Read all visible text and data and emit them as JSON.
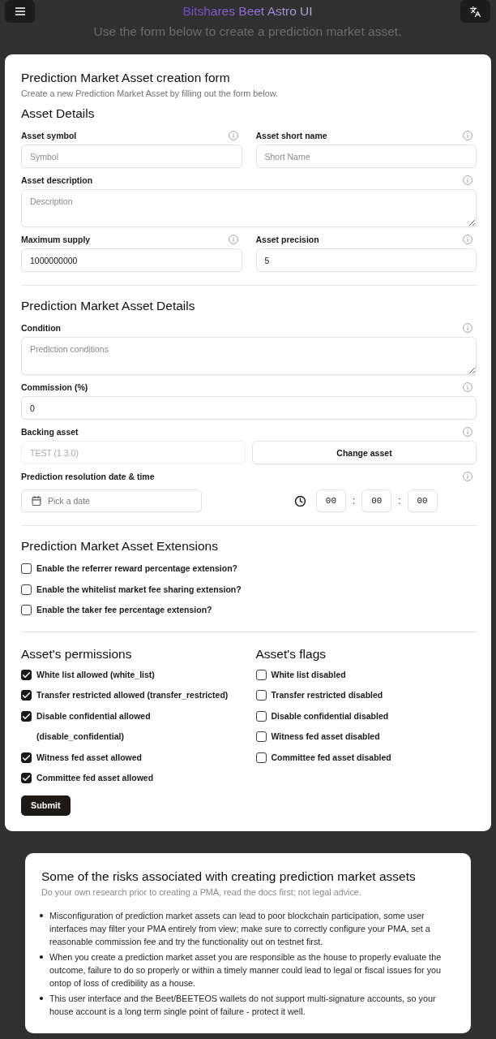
{
  "header": {
    "title": "Bitshares Beet Astro UI",
    "subtitle": "Use the form below to create a prediction market asset."
  },
  "form": {
    "title": "Prediction Market Asset creation form",
    "description": "Create a new Prediction Market Asset by filling out the form below.",
    "sections": [
      {
        "title": "Asset Details",
        "rows": [
          [
            {
              "kind": "text",
              "label": "Asset symbol",
              "placeholder": "Symbol"
            },
            {
              "kind": "text",
              "label": "Asset short name",
              "placeholder": "Short Name"
            }
          ],
          [
            {
              "kind": "textarea",
              "label": "Asset description",
              "placeholder": "Description"
            }
          ],
          [
            {
              "kind": "text",
              "label": "Maximum supply",
              "value": "1000000000"
            },
            {
              "kind": "text",
              "label": "Asset precision",
              "value": "5"
            }
          ]
        ]
      },
      {
        "title": "Prediction Market Asset Details",
        "rows": [
          [
            {
              "kind": "textarea",
              "label": "Condition",
              "placeholder": "Prediction conditions"
            }
          ],
          [
            {
              "kind": "text",
              "label": "Commission (%)",
              "value": "0"
            }
          ],
          [
            {
              "kind": "asset",
              "label": "Backing asset",
              "value": "TEST (1.3.0)",
              "disabled": true,
              "button": "Change asset"
            }
          ],
          [
            {
              "kind": "datetime",
              "label": "Prediction resolution date & time",
              "placeholder": "Pick a date",
              "time": [
                "00",
                "00",
                "00"
              ],
              "separators": [
                ":",
                ":"
              ]
            }
          ]
        ]
      }
    ],
    "extensions": {
      "title": "Prediction Market Asset Extensions",
      "items": [
        {
          "label": "Enable the referrer reward percentage extension?",
          "checked": false
        },
        {
          "label": "Enable the whitelist market fee sharing extension?",
          "checked": false
        },
        {
          "label": "Enable the taker fee percentage extension?",
          "checked": false
        }
      ]
    },
    "permissions": {
      "title": "Asset's permissions",
      "items": [
        {
          "label": "White list allowed (white_list)",
          "checked": true
        },
        {
          "label": "Transfer restricted allowed (transfer_restricted)",
          "checked": true
        },
        {
          "label": "Disable confidential allowed (disable_confidential)",
          "checked": true
        },
        {
          "label": "Witness fed asset allowed",
          "checked": true
        },
        {
          "label": "Committee fed asset allowed",
          "checked": true
        }
      ]
    },
    "flags": {
      "title": "Asset's flags",
      "items": [
        {
          "label": "White list disabled",
          "checked": false
        },
        {
          "label": "Transfer restricted disabled",
          "checked": false
        },
        {
          "label": "Disable confidential disabled",
          "checked": false
        },
        {
          "label": "Witness fed asset disabled",
          "checked": false
        },
        {
          "label": "Committee fed asset disabled",
          "checked": false
        }
      ]
    },
    "submit": "Submit"
  },
  "risks": {
    "title": "Some of the risks associated with creating prediction market assets",
    "subtitle": "Do your own research prior to creating a PMA, read the docs first; not legal advice.",
    "items": [
      "Misconfiguration of prediction market assets can lead to poor blockchain participation, some user interfaces may filter your PMA entirely from view; make sure to correctly configure your PMA, set a reasonable commission fee and try the functionality out on testnet first.",
      "When you create a prediction market asset you are responsible as the house to properly evaluate the outcome, failure to do so properly or within a timely manner could lead to legal or fiscal issues for you ontop of loss of credibility as a house.",
      "This user interface and the Beet/BEETEOS wallets do not support multi-signature accounts, so your house account is a long term single point of failure - protect it well."
    ]
  }
}
